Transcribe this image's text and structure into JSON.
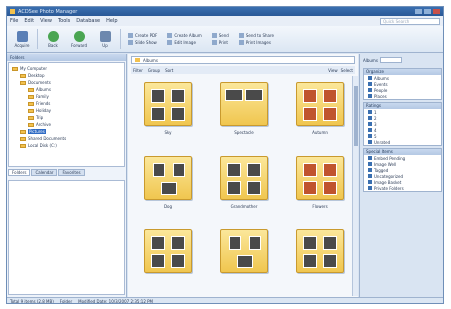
{
  "window": {
    "title": "ACDSee Photo Manager"
  },
  "menu": [
    "File",
    "Edit",
    "View",
    "Tools",
    "Database",
    "Help"
  ],
  "search": {
    "placeholder": "Quick Search"
  },
  "toolbar": {
    "buttons": [
      {
        "label": "Acquire",
        "icon": "camera-icon",
        "color": "#5a7fb6"
      },
      {
        "label": "Back",
        "icon": "back-icon",
        "color": "#4aa552"
      },
      {
        "label": "Forward",
        "icon": "forward-icon",
        "color": "#4aa552"
      },
      {
        "label": "Up",
        "icon": "up-icon",
        "color": "#6d88ae"
      }
    ],
    "groups": [
      [
        "Create PDF",
        "Slide Show"
      ],
      [
        "Create Album",
        "Edit Image"
      ],
      [
        "Send",
        "Print"
      ],
      [
        "Send to Share",
        "Print Images"
      ]
    ]
  },
  "left": {
    "header": "Folders",
    "tree": [
      {
        "label": "My Computer",
        "indent": 0
      },
      {
        "label": "Desktop",
        "indent": 1
      },
      {
        "label": "Documents",
        "indent": 1
      },
      {
        "label": "Albums",
        "indent": 2
      },
      {
        "label": "Family",
        "indent": 2
      },
      {
        "label": "Friends",
        "indent": 2
      },
      {
        "label": "Holiday",
        "indent": 2
      },
      {
        "label": "Trip",
        "indent": 2
      },
      {
        "label": "Archive",
        "indent": 2
      },
      {
        "label": "Pictures",
        "indent": 1,
        "selected": true
      },
      {
        "label": "Shared Documents",
        "indent": 1
      },
      {
        "label": "Local Disk (C:)",
        "indent": 1
      }
    ],
    "tabs": [
      "Folders",
      "Calendar",
      "Favorites"
    ]
  },
  "center": {
    "address": "Albums",
    "subbar": [
      "Filter",
      "Group",
      "Sort"
    ],
    "subbar_right": [
      "View",
      "Select"
    ],
    "tiles": [
      {
        "label": "Sky",
        "layout": "grid4"
      },
      {
        "label": "Spectacle",
        "layout": "wide"
      },
      {
        "label": "Autumn",
        "layout": "grid4o"
      },
      {
        "label": "Dog",
        "layout": "grid3"
      },
      {
        "label": "Grandmother",
        "layout": "grid4"
      },
      {
        "label": "Flowers",
        "layout": "grid4o"
      },
      {
        "label": "",
        "layout": "grid4"
      },
      {
        "label": "",
        "layout": "grid3"
      },
      {
        "label": "",
        "layout": "grid4"
      }
    ]
  },
  "right": {
    "top_label": "Albums",
    "boxes": [
      {
        "header": "Organize",
        "items": [
          "Albums",
          "Events",
          "People",
          "Places"
        ]
      },
      {
        "header": "Ratings",
        "items": [
          "1",
          "2",
          "3",
          "4",
          "5",
          "Unrated"
        ]
      },
      {
        "header": "Special Items",
        "items": [
          "Embed Pending",
          "Image Well",
          "Tagged",
          "Uncategorized",
          "Image Basket",
          "Private Folders"
        ]
      }
    ]
  },
  "status": [
    "Total 9 items (2.8 MB)",
    "Folder",
    "Modified Date: 10/3/2007 2:35:12 PM"
  ]
}
